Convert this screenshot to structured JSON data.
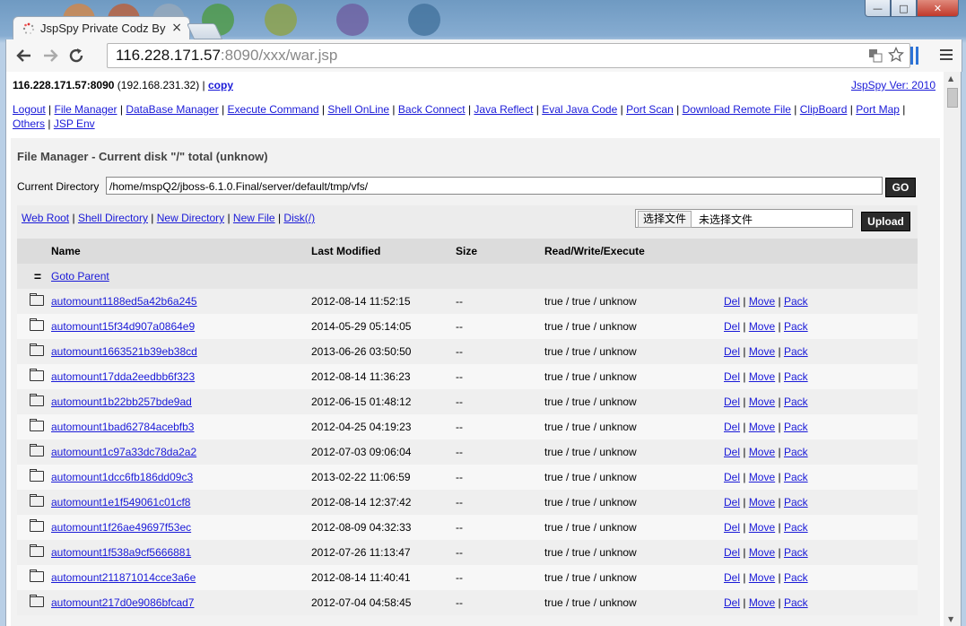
{
  "browser": {
    "tab_title": "JspSpy Private Codz By",
    "tab_close": "×",
    "url_host": "116.228.171.57",
    "url_rest": ":8090/xxx/war.jsp"
  },
  "header": {
    "host": "116.228.171.57:8090",
    "local_ip": " (192.168.231.32) | ",
    "copy_link": "copy",
    "version_link": "JspSpy Ver: 2010"
  },
  "nav": [
    {
      "label": "Logout"
    },
    {
      "label": "File Manager"
    },
    {
      "label": "DataBase Manager"
    },
    {
      "label": "Execute Command"
    },
    {
      "label": "Shell OnLine"
    },
    {
      "label": "Back Connect"
    },
    {
      "label": "Java Reflect"
    },
    {
      "label": "Eval Java Code"
    },
    {
      "label": "Port Scan"
    },
    {
      "label": "Download Remote File"
    },
    {
      "label": "ClipBoard"
    },
    {
      "label": "Port Map"
    },
    {
      "label": "Others"
    },
    {
      "label": "JSP Env"
    }
  ],
  "file_manager": {
    "title": "File Manager - Current disk \"/\" total (unknow)",
    "current_directory_label": "Current Directory",
    "current_directory_value": "/home/mspQ2/jboss-6.1.0.Final/server/default/tmp/vfs/",
    "go_label": "GO",
    "quick_links": [
      {
        "label": "Web Root"
      },
      {
        "label": "Shell Directory"
      },
      {
        "label": "New Directory"
      },
      {
        "label": "New File"
      },
      {
        "label": "Disk(/)"
      }
    ],
    "choose_file_label": "选择文件",
    "no_file_label": "未选择文件",
    "upload_label": "Upload",
    "columns": {
      "name": "Name",
      "modified": "Last Modified",
      "size": "Size",
      "perm": "Read/Write/Execute"
    },
    "parent_label": "Goto Parent",
    "parent_icon": "=",
    "actions": {
      "del": "Del",
      "move": "Move",
      "pack": "Pack"
    },
    "rows": [
      {
        "name": "automount1188ed5a42b6a245",
        "modified": "2012-08-14 11:52:15",
        "size": "--",
        "perm": "true / true / unknow"
      },
      {
        "name": "automount15f34d907a0864e9",
        "modified": "2014-05-29 05:14:05",
        "size": "--",
        "perm": "true / true / unknow"
      },
      {
        "name": "automount1663521b39eb38cd",
        "modified": "2013-06-26 03:50:50",
        "size": "--",
        "perm": "true / true / unknow"
      },
      {
        "name": "automount17dda2eedbb6f323",
        "modified": "2012-08-14 11:36:23",
        "size": "--",
        "perm": "true / true / unknow"
      },
      {
        "name": "automount1b22bb257bde9ad",
        "modified": "2012-06-15 01:48:12",
        "size": "--",
        "perm": "true / true / unknow"
      },
      {
        "name": "automount1bad62784acebfb3",
        "modified": "2012-04-25 04:19:23",
        "size": "--",
        "perm": "true / true / unknow"
      },
      {
        "name": "automount1c97a33dc78da2a2",
        "modified": "2012-07-03 09:06:04",
        "size": "--",
        "perm": "true / true / unknow"
      },
      {
        "name": "automount1dcc6fb186dd09c3",
        "modified": "2013-02-22 11:06:59",
        "size": "--",
        "perm": "true / true / unknow"
      },
      {
        "name": "automount1e1f549061c01cf8",
        "modified": "2012-08-14 12:37:42",
        "size": "--",
        "perm": "true / true / unknow"
      },
      {
        "name": "automount1f26ae49697f53ec",
        "modified": "2012-08-09 04:32:33",
        "size": "--",
        "perm": "true / true / unknow"
      },
      {
        "name": "automount1f538a9cf5666881",
        "modified": "2012-07-26 11:13:47",
        "size": "--",
        "perm": "true / true / unknow"
      },
      {
        "name": "automount211871014cce3a6e",
        "modified": "2012-08-14 11:40:41",
        "size": "--",
        "perm": "true / true / unknow"
      },
      {
        "name": "automount217d0e9086bfcad7",
        "modified": "2012-07-04 04:58:45",
        "size": "--",
        "perm": "true / true / unknow"
      }
    ]
  }
}
